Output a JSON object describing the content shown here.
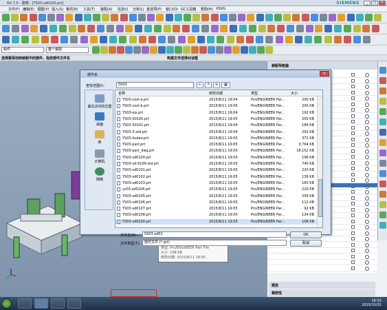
{
  "window": {
    "title": "NX 7.5 - 建模 - [YS03-sd0100.prt]",
    "brand": "SIEMENS",
    "min": "_",
    "max": "□",
    "close": "✕"
  },
  "menu": [
    "文件(F)",
    "编辑(E)",
    "视图(V)",
    "插入(S)",
    "格式(R)",
    "工具(T)",
    "装配(A)",
    "信息(I)",
    "分析(L)",
    "首选项(P)",
    "窗口(O)",
    "GC工具箱",
    "帮助(H)",
    "XSUG"
  ],
  "filter": {
    "selection": "组件",
    "scope": "整个装配"
  },
  "cue": {
    "left": "选择要添加到装配中的部件，指定部件文件名",
    "center": "构建文件选择对话框"
  },
  "asm_nav": {
    "title": "装配导航器",
    "sections": [
      "预览",
      "相依性"
    ]
  },
  "dialog": {
    "title": "部件名",
    "close": "✕",
    "look_in_label": "查找范围(I):",
    "look_in_value": "5S03",
    "places": [
      "最近访问的位置",
      "桌面",
      "库",
      "计算机",
      "网络"
    ],
    "columns": {
      "name": "名称",
      "date": "修改日期",
      "type": "类型",
      "size": "大小"
    },
    "files": [
      {
        "name": "YS03-cool-e.prt",
        "date": "2015/8/11 19:04",
        "type": "Pro/ENGINEER Par...",
        "size": "200 KB"
      },
      {
        "name": "YS03-cool-b.prt",
        "date": "2015/8/11 19:05",
        "type": "Pro/ENGINEER Par...",
        "size": "200 KB"
      },
      {
        "name": "YS03-ejs.prt",
        "date": "2015/8/11 19:04",
        "type": "Pro/ENGINEER Par...",
        "size": "192 KB"
      },
      {
        "name": "YS03-S0100.prt",
        "date": "2015/8/11 19:05",
        "type": "Pro/ENGINEER Par...",
        "size": "200 KB"
      },
      {
        "name": "YS03-S0101.prt",
        "date": "2015/8/11 19:04",
        "type": "Pro/ENGINEER Par...",
        "size": "184 KB"
      },
      {
        "name": "YS03-3-std.prt",
        "date": "2015/8/11 19:04",
        "type": "Pro/ENGINEER Par...",
        "size": "292 KB"
      },
      {
        "name": "YS03-liudao.prt",
        "date": "2015/8/11 19:05",
        "type": "Pro/ENGINEER Par...",
        "size": "372 KB"
      },
      {
        "name": "YS03-part.prt",
        "date": "2015/8/11 19:05",
        "type": "Pro/ENGINEER Par...",
        "size": "3,764 KB"
      },
      {
        "name": "YS03-part_dwg.prt",
        "date": "2015/8/11 19:05",
        "type": "Pro/ENGINEER Par...",
        "size": "18,152 KB"
      },
      {
        "name": "YS03-sd0100.prt",
        "date": "2015/8/11 19:05",
        "type": "Pro/ENGINEER Par...",
        "size": "196 KB"
      },
      {
        "name": "YS03-sd-0100-std.prt",
        "date": "2015/8/11 19:05",
        "type": "Pro/ENGINEER Par...",
        "size": "740 KB"
      },
      {
        "name": "YS03-sd0101.prt",
        "date": "2015/8/11 19:05",
        "type": "Pro/ENGINEER Par...",
        "size": "220 KB"
      },
      {
        "name": "YS03-sd0102.prt",
        "date": "2015/8/11 19:05",
        "type": "Pro/ENGINEER Par...",
        "size": "136 KB"
      },
      {
        "name": "YS03-sd0103.prt",
        "date": "2015/8/11 19:05",
        "type": "Pro/ENGINEER Par...",
        "size": "160 KB"
      },
      {
        "name": "ys03-sd0104.prt",
        "date": "2015/8/11 19:05",
        "type": "Pro/ENGINEER Par...",
        "size": "220 KB"
      },
      {
        "name": "YS03-sd0105.prt",
        "date": "2015/8/11 19:05",
        "type": "Pro/ENGINEER Par...",
        "size": "256 KB"
      },
      {
        "name": "YS03-sd0106.prt",
        "date": "2015/8/11 19:05",
        "type": "Pro/ENGINEER Par...",
        "size": "112 KB"
      },
      {
        "name": "YS03-sd0107.prt",
        "date": "2015/8/11 19:05",
        "type": "Pro/ENGINEER Par...",
        "size": "92 KB"
      },
      {
        "name": "YS03-sd0108.prt",
        "date": "2015/8/11 19:05",
        "type": "Pro/ENGINEER Par...",
        "size": "124 KB"
      },
      {
        "name": "YS03-sd0200.prt",
        "date": "2015/8/11 19:05",
        "type": "Pro/ENGINEER Par...",
        "size": "108 KB"
      }
    ],
    "selected_file": "YS03-sd0200.prt",
    "tooltip": {
      "type": "类型: Pro/ENGINEER Part File",
      "size": "大小: 108 KB",
      "date": "修改日期: 2015/8/11 19:05"
    },
    "file_name_label": "文件名(N):",
    "file_name_value": "5S03-sd02",
    "file_type_label": "文件类型(T):",
    "file_type_value": "部件文件 (*.prt)",
    "ok": "OK",
    "cancel": "取消"
  },
  "taskbar": {
    "time": "16:53",
    "date": "2015/10/31"
  },
  "colors": {
    "accent": "#3d6fb5",
    "close": "#c75050",
    "selection_outline": "#d22222",
    "siemens": "#0a8f8f"
  }
}
